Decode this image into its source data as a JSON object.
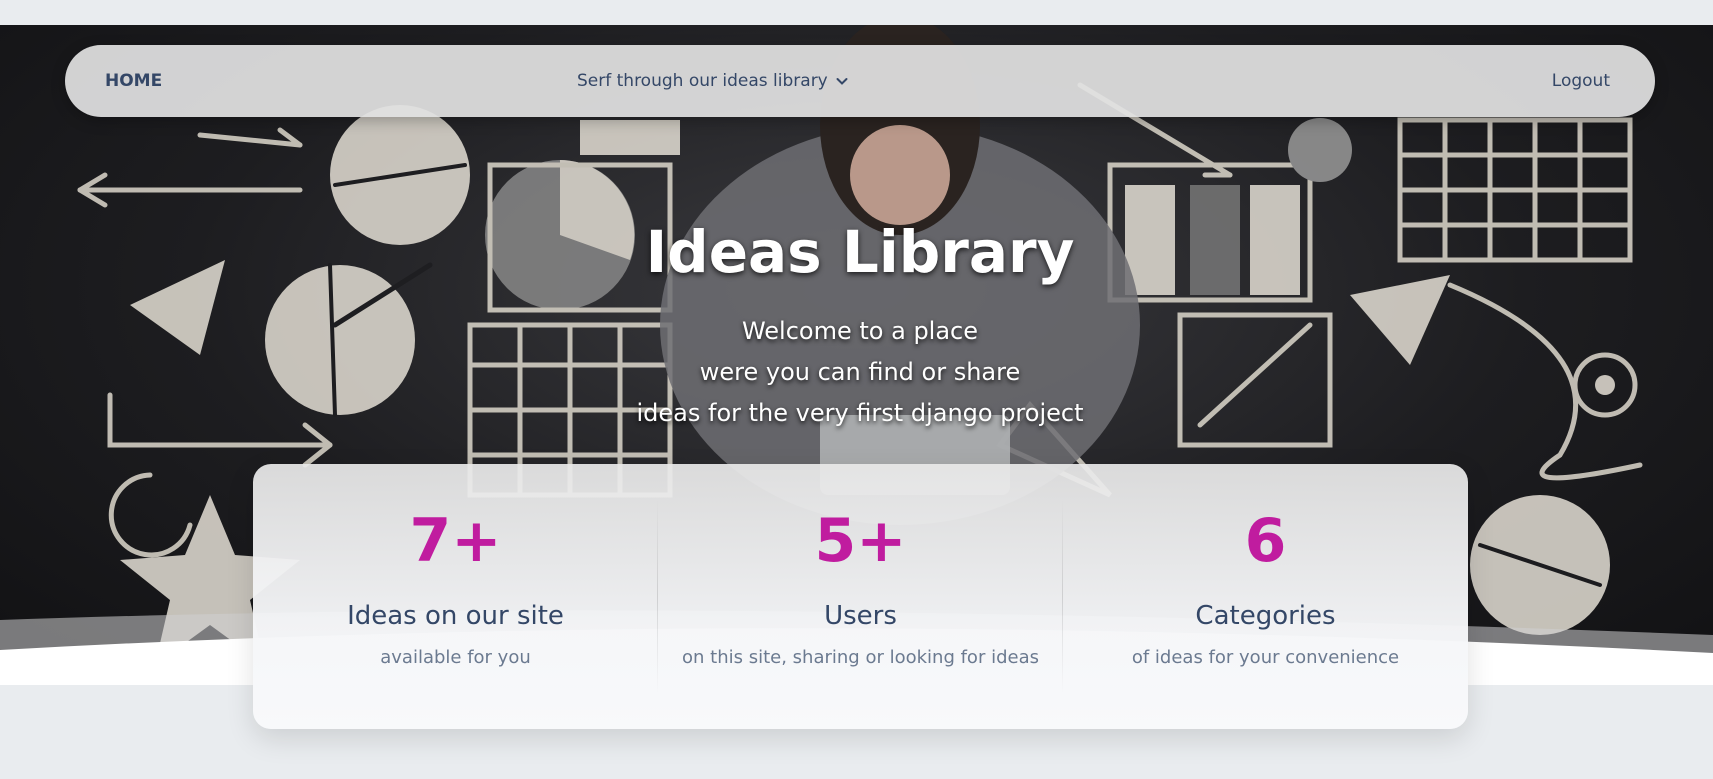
{
  "nav": {
    "home": "HOME",
    "dropdown": "Serf through our ideas library",
    "logout": "Logout"
  },
  "hero": {
    "title": "Ideas Library",
    "lines": [
      "Welcome to a place",
      "were you can find or share",
      "ideas for the very first django project"
    ]
  },
  "stats": [
    {
      "number": "7+",
      "title": "Ideas on our site",
      "desc": "available for you"
    },
    {
      "number": "5+",
      "title": "Users",
      "desc": "on this site, sharing or looking for ideas"
    },
    {
      "number": "6",
      "title": "Categories",
      "desc": "of ideas for your convenience"
    }
  ],
  "colors": {
    "accent": "#c01c9f",
    "text": "#344767",
    "muted": "#6b7a90",
    "page_bg": "#e9ecef"
  }
}
